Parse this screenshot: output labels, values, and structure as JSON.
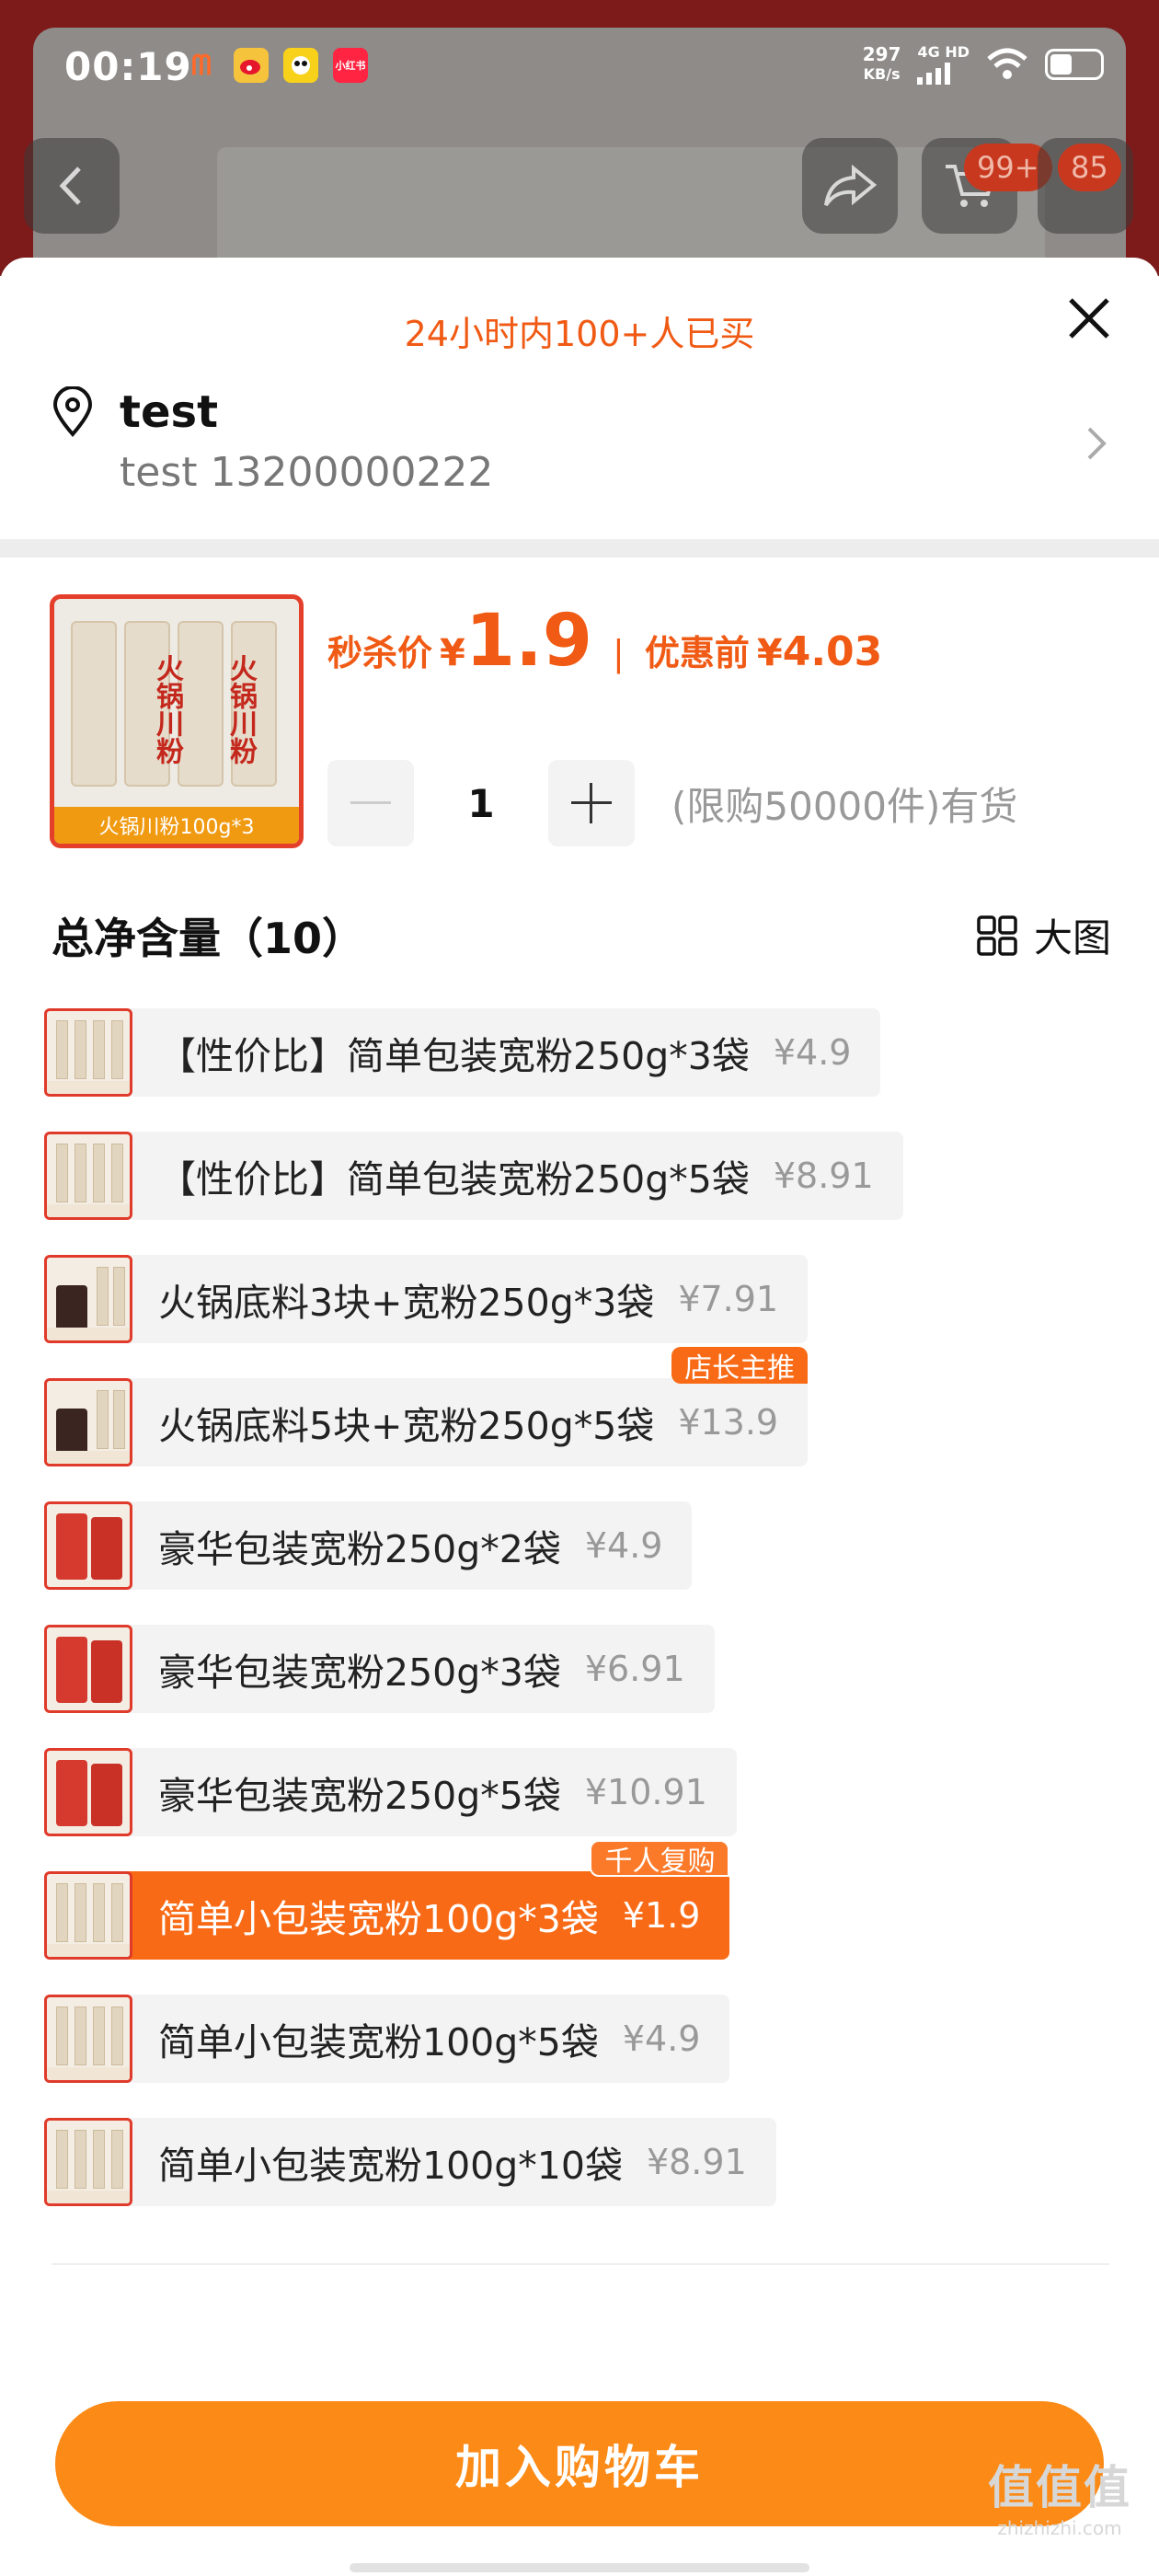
{
  "status_bar": {
    "time": "00:19",
    "apps": [
      "微博",
      "鼠",
      "小红书"
    ],
    "speed": "297",
    "speed_unit": "KB/s",
    "network": "4G HD"
  },
  "top_nav": {
    "cart_badge": "99+",
    "msg_badge": "85"
  },
  "sheet": {
    "bought_notice": "24小时内100+人已买",
    "address": {
      "name": "test",
      "contact": "test 13200000222"
    },
    "product": {
      "thumb_caption": "火锅川粉100g*3",
      "pack_label": "火锅川粉",
      "flash_label": "秒杀价",
      "currency": "¥",
      "flash_price": "1.9",
      "separator": "|",
      "original_label": "优惠前",
      "original_price": "4.03",
      "quantity": "1",
      "stock_text": "(限购50000件)有货"
    },
    "section_title": "总净含量（10）",
    "big_view_label": "大图",
    "options": [
      {
        "name": "【性价比】简单包装宽粉250g*3袋",
        "price": "¥4.9",
        "thumb": "packs",
        "selected": false,
        "tag": ""
      },
      {
        "name": "【性价比】简单包装宽粉250g*5袋",
        "price": "¥8.91",
        "thumb": "packs",
        "selected": false,
        "tag": ""
      },
      {
        "name": "火锅底料3块+宽粉250g*3袋",
        "price": "¥7.91",
        "thumb": "combo",
        "selected": false,
        "tag": ""
      },
      {
        "name": "火锅底料5块+宽粉250g*5袋",
        "price": "¥13.9",
        "thumb": "combo",
        "selected": false,
        "tag": "店长主推"
      },
      {
        "name": "豪华包装宽粉250g*2袋",
        "price": "¥4.9",
        "thumb": "red",
        "selected": false,
        "tag": ""
      },
      {
        "name": "豪华包装宽粉250g*3袋",
        "price": "¥6.91",
        "thumb": "red",
        "selected": false,
        "tag": ""
      },
      {
        "name": "豪华包装宽粉250g*5袋",
        "price": "¥10.91",
        "thumb": "red",
        "selected": false,
        "tag": ""
      },
      {
        "name": "简单小包装宽粉100g*3袋",
        "price": "¥1.9",
        "thumb": "packs",
        "selected": true,
        "tag": "千人复购"
      },
      {
        "name": "简单小包装宽粉100g*5袋",
        "price": "¥4.9",
        "thumb": "packs",
        "selected": false,
        "tag": ""
      },
      {
        "name": "简单小包装宽粉100g*10袋",
        "price": "¥8.91",
        "thumb": "packs",
        "selected": false,
        "tag": ""
      }
    ],
    "add_to_cart_label": "加入购物车"
  },
  "watermark": {
    "main": "值值值",
    "sub": "zhizhizhi.com"
  },
  "colors": {
    "accent": "#f05a14",
    "cart_button": "#fb8a16",
    "selected_option": "#f96a16"
  }
}
